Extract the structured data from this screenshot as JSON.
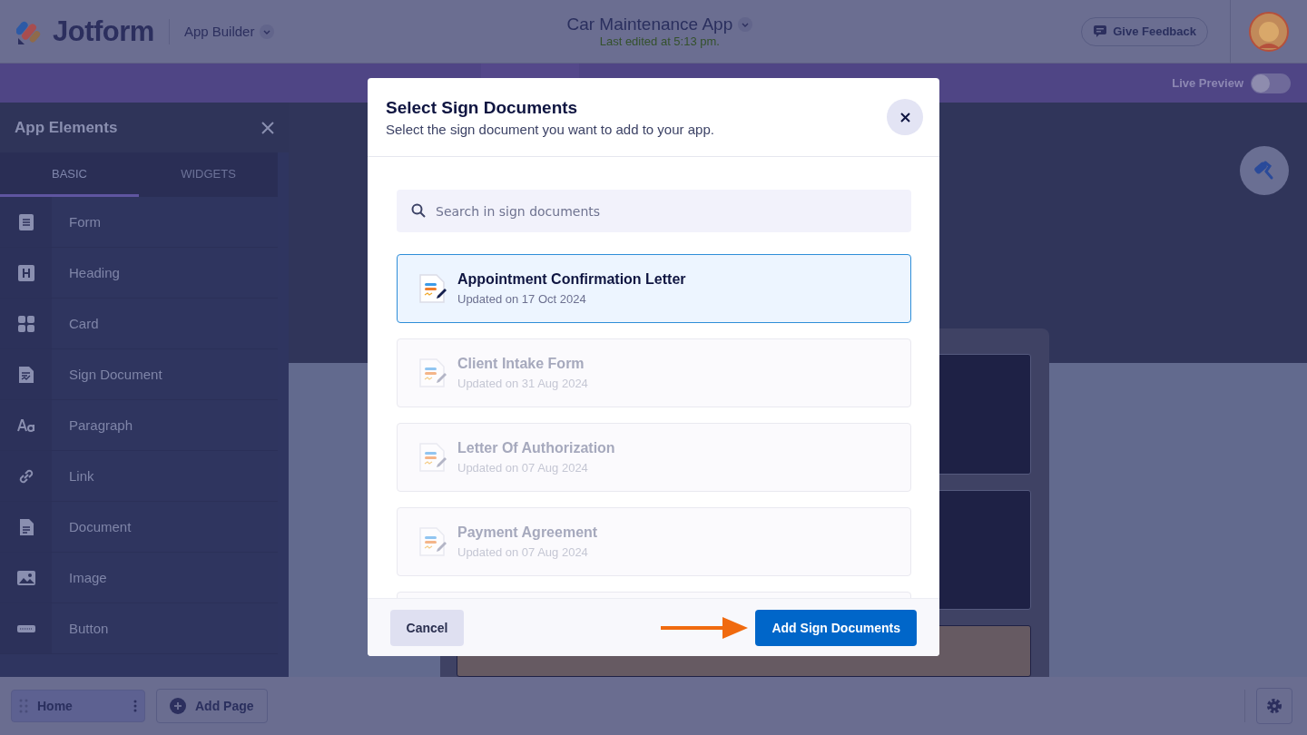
{
  "header": {
    "logo": "Jotform",
    "product": "App Builder",
    "app_title": "Car Maintenance App",
    "last_edited": "Last edited at 5:13 pm.",
    "feedback_button": "Give Feedback"
  },
  "toolbar": {
    "live_preview": {
      "label": "Live Preview",
      "on": false
    }
  },
  "sidebar": {
    "title": "App Elements",
    "tabs": [
      {
        "label": "BASIC",
        "selected": true
      },
      {
        "label": "WIDGETS",
        "selected": false
      }
    ],
    "items": [
      {
        "label": "Form",
        "kind": "form"
      },
      {
        "label": "Heading",
        "kind": "heading"
      },
      {
        "label": "Card",
        "kind": "card"
      },
      {
        "label": "Sign Document",
        "kind": "sign"
      },
      {
        "label": "Paragraph",
        "kind": "paragraph"
      },
      {
        "label": "Link",
        "kind": "link"
      },
      {
        "label": "Document",
        "kind": "document"
      },
      {
        "label": "Image",
        "kind": "image"
      },
      {
        "label": "Button",
        "kind": "button"
      }
    ]
  },
  "dialog": {
    "title": "Select Sign Documents",
    "subtitle": "Select the sign document you want to add to your app.",
    "search": {
      "placeholder": "Search in sign documents"
    },
    "documents": [
      {
        "name": "Appointment Confirmation Letter",
        "updated": "Updated on 17 Oct 2024",
        "selected": true
      },
      {
        "name": "Client Intake Form",
        "updated": "Updated on 31 Aug 2024",
        "selected": false
      },
      {
        "name": "Letter Of Authorization",
        "updated": "Updated on 07 Aug 2024",
        "selected": false
      },
      {
        "name": "Payment Agreement",
        "updated": "Updated on 07 Aug 2024",
        "selected": false
      }
    ],
    "cancel_button": "Cancel",
    "add_button": "Add Sign Documents"
  },
  "pages_bar": {
    "pages": [
      {
        "label": "Home",
        "selected": true
      }
    ],
    "add_page_button": "Add Page"
  }
}
